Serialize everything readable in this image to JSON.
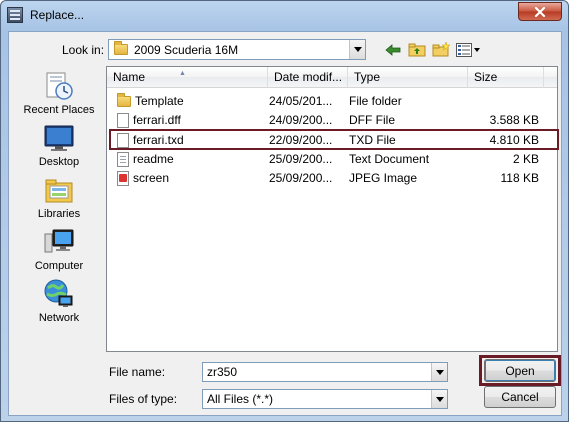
{
  "window": {
    "title": "Replace..."
  },
  "lookin": {
    "label": "Look in:",
    "value": "2009 Scuderia 16M"
  },
  "places": [
    {
      "label": "Recent Places",
      "icon": "recent-places-icon"
    },
    {
      "label": "Desktop",
      "icon": "desktop-icon"
    },
    {
      "label": "Libraries",
      "icon": "libraries-icon"
    },
    {
      "label": "Computer",
      "icon": "computer-icon"
    },
    {
      "label": "Network",
      "icon": "network-icon"
    }
  ],
  "columns": {
    "name": "Name",
    "date": "Date modif...",
    "type": "Type",
    "size": "Size"
  },
  "files": [
    {
      "name": "Template",
      "date": "24/05/201...",
      "type": "File folder",
      "size": "",
      "icon": "folder-icon"
    },
    {
      "name": "ferrari.dff",
      "date": "24/09/200...",
      "type": "DFF File",
      "size": "3.588 KB",
      "icon": "file-icon"
    },
    {
      "name": "ferrari.txd",
      "date": "22/09/200...",
      "type": "TXD File",
      "size": "4.810 KB",
      "icon": "file-icon"
    },
    {
      "name": "readme",
      "date": "25/09/200...",
      "type": "Text Document",
      "size": "2 KB",
      "icon": "text-file-icon"
    },
    {
      "name": "screen",
      "date": "25/09/200...",
      "type": "JPEG Image",
      "size": "118 KB",
      "icon": "image-icon"
    }
  ],
  "filename": {
    "label": "File name:",
    "value": "zr350"
  },
  "filetype": {
    "label": "Files of type:",
    "value": "All Files (*.*)"
  },
  "buttons": {
    "open": "Open",
    "cancel": "Cancel"
  },
  "colors": {
    "highlight_outline": "#6b1b25",
    "titlebar": "#bcd5ef",
    "close": "#c8553d"
  }
}
